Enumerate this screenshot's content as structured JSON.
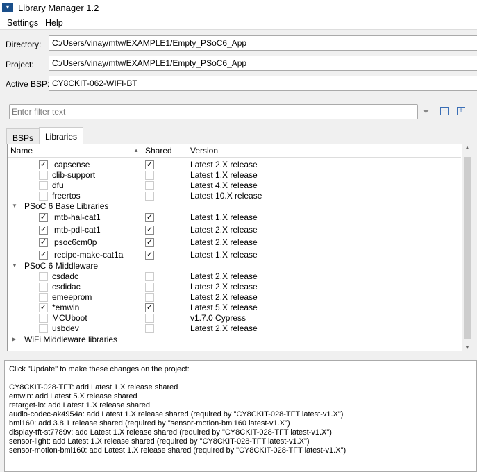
{
  "window": {
    "title": "Library Manager 1.2"
  },
  "menu": [
    "Settings",
    "Help"
  ],
  "form": {
    "directory_label": "Directory:",
    "directory": "C:/Users/vinay/mtw/EXAMPLE1/Empty_PSoC6_App",
    "project_label": "Project:",
    "project": "C:/Users/vinay/mtw/EXAMPLE1/Empty_PSoC6_App",
    "bsp_label": "Active BSP:",
    "bsp": "CY8CKIT-062-WIFI-BT"
  },
  "filter": {
    "placeholder": "Enter filter text"
  },
  "tabs": [
    "BSPs",
    "Libraries"
  ],
  "columns": [
    "Name",
    "Shared",
    "Version"
  ],
  "rows": [
    {
      "type": "item",
      "name": "capsense",
      "locked": true,
      "checked": true,
      "shared": true,
      "version": "Latest 2.X release"
    },
    {
      "type": "item",
      "name": "clib-support",
      "locked": false,
      "checked": false,
      "shared": false,
      "version": "Latest 1.X release"
    },
    {
      "type": "item",
      "name": "dfu",
      "locked": false,
      "checked": false,
      "shared": false,
      "version": "Latest 4.X release"
    },
    {
      "type": "item",
      "name": "freertos",
      "locked": false,
      "checked": false,
      "shared": false,
      "version": "Latest 10.X release"
    },
    {
      "type": "group",
      "name": "PSoC 6 Base Libraries",
      "expanded": true
    },
    {
      "type": "item",
      "name": "mtb-hal-cat1",
      "locked": true,
      "checked": true,
      "shared": true,
      "version": "Latest 1.X release"
    },
    {
      "type": "item",
      "name": "mtb-pdl-cat1",
      "locked": true,
      "checked": true,
      "shared": true,
      "version": "Latest 2.X release"
    },
    {
      "type": "item",
      "name": "psoc6cm0p",
      "locked": true,
      "checked": true,
      "shared": true,
      "version": "Latest 2.X release"
    },
    {
      "type": "item",
      "name": "recipe-make-cat1a",
      "locked": true,
      "checked": true,
      "shared": true,
      "version": "Latest 1.X release"
    },
    {
      "type": "group",
      "name": "PSoC 6 Middleware",
      "expanded": true
    },
    {
      "type": "item",
      "name": "csdadc",
      "locked": false,
      "checked": false,
      "shared": false,
      "version": "Latest 2.X release"
    },
    {
      "type": "item",
      "name": "csdidac",
      "locked": false,
      "checked": false,
      "shared": false,
      "version": "Latest 2.X release"
    },
    {
      "type": "item",
      "name": "emeeprom",
      "locked": false,
      "checked": false,
      "shared": false,
      "version": "Latest 2.X release"
    },
    {
      "type": "item",
      "name": "*emwin",
      "locked": false,
      "checked": true,
      "shared": true,
      "version": "Latest 5.X release"
    },
    {
      "type": "item",
      "name": "MCUboot",
      "locked": false,
      "checked": false,
      "shared": false,
      "version": "v1.7.0 Cypress"
    },
    {
      "type": "item",
      "name": "usbdev",
      "locked": false,
      "checked": false,
      "shared": false,
      "version": "Latest 2.X release"
    },
    {
      "type": "group",
      "name": "WiFi Middleware libraries",
      "expanded": false
    }
  ],
  "output": [
    "Click \"Update\" to make these changes on the project:",
    "",
    "CY8CKIT-028-TFT: add Latest 1.X release shared",
    "emwin: add Latest 5.X release shared",
    "retarget-io: add Latest 1.X release shared",
    "audio-codec-ak4954a: add Latest 1.X release shared (required by \"CY8CKIT-028-TFT latest-v1.X\")",
    "bmi160: add 3.8.1 release shared (required by \"sensor-motion-bmi160 latest-v1.X\")",
    "display-tft-st7789v: add Latest 1.X release shared (required by \"CY8CKIT-028-TFT latest-v1.X\")",
    "sensor-light: add Latest 1.X release shared (required by \"CY8CKIT-028-TFT latest-v1.X\")",
    "sensor-motion-bmi160: add Latest 1.X release shared (required by \"CY8CKIT-028-TFT latest-v1.X\")"
  ]
}
